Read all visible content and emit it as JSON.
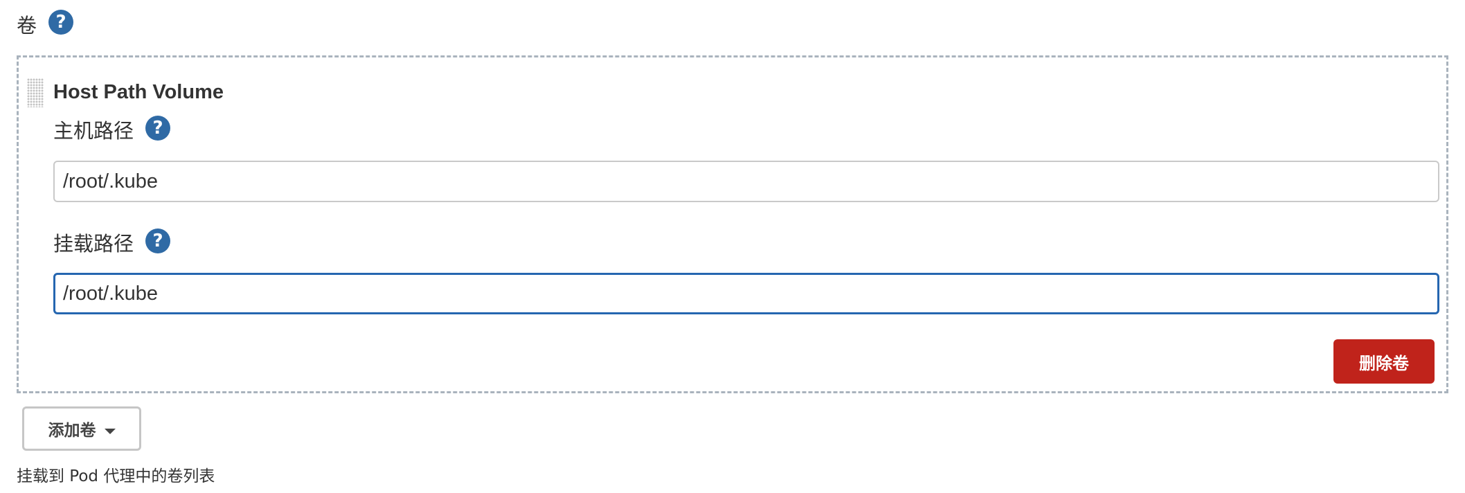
{
  "section": {
    "label": "卷",
    "help_glyph": "?"
  },
  "volume": {
    "title": "Host Path Volume",
    "host_path": {
      "label": "主机路径",
      "help_glyph": "?",
      "value": "/root/.kube"
    },
    "mount_path": {
      "label": "挂载路径",
      "help_glyph": "?",
      "value": "/root/.kube"
    },
    "delete_label": "删除卷"
  },
  "add_volume": {
    "label": "添加卷"
  },
  "description": "挂载到 Pod 代理中的卷列表",
  "icons": {
    "help": "help-icon",
    "drag": "drag-handle-icon",
    "dropdown": "caret-down-icon"
  },
  "colors": {
    "help_icon": "#2f6aa5",
    "delete_button": "#c0231b",
    "focused_input_border": "#2566b0",
    "dashed_border": "#a9b3bd"
  }
}
